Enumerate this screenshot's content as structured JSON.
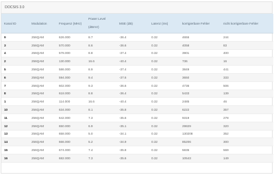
{
  "panel": {
    "title": "DOCSIS 3.0"
  },
  "columns": {
    "kanal_id": "Kanal ID",
    "modulation": "Modulation",
    "frequenz": "Frequenz (MHz)",
    "power_level_line1": "Power Level",
    "power_level_line2": "(dBmV)",
    "mse": "MSE (dB)",
    "latenz": "Latenz (ms)",
    "korrigierbare": "korrigierbare Fehler",
    "nicht_korrigierbare": "nicht korrigierbare Fehler"
  },
  "rows": [
    [
      "9",
      "256QAM",
      "626.000",
      "8.7",
      "-36.4",
      "0.32",
      "4655",
      "244"
    ],
    [
      "3",
      "256QAM",
      "570.000",
      "8.6",
      "-36.6",
      "0.32",
      "4058",
      "83"
    ],
    [
      "4",
      "256QAM",
      "578.000",
      "8.8",
      "-37.4",
      "0.32",
      "3901",
      "400"
    ],
    [
      "2",
      "256QAM",
      "130.000",
      "16.6",
      "-40.4",
      "0.32",
      "736",
      "16"
    ],
    [
      "5",
      "256QAM",
      "586.000",
      "8.9",
      "-37.4",
      "0.32",
      "3849",
      "441"
    ],
    [
      "6",
      "256QAM",
      "594.000",
      "9.4",
      "-37.6",
      "0.32",
      "3650",
      "333"
    ],
    [
      "7",
      "256QAM",
      "602.000",
      "9.3",
      "-36.6",
      "0.32",
      "4736",
      "506"
    ],
    [
      "8",
      "256QAM",
      "618.000",
      "8.8",
      "-36.4",
      "0.32",
      "5433",
      "139"
    ],
    [
      "1",
      "256QAM",
      "114.000",
      "16.6",
      "-40.4",
      "0.32",
      "2485",
      "46"
    ],
    [
      "10",
      "256QAM",
      "634.000",
      "8.1",
      "-35.8",
      "0.32",
      "6222",
      "357"
    ],
    [
      "11",
      "256QAM",
      "642.000",
      "7.3",
      "-35.6",
      "0.32",
      "9319",
      "278"
    ],
    [
      "12",
      "256QAM",
      "650.000",
      "6.9",
      "-35.1",
      "0.32",
      "29829",
      "320"
    ],
    [
      "13",
      "256QAM",
      "658.000",
      "5.0",
      "-34.1",
      "0.32",
      "130208",
      "352"
    ],
    [
      "14",
      "256QAM",
      "666.000",
      "5.2",
      "-34.9",
      "0.32",
      "85206",
      "300"
    ],
    [
      "15",
      "256QAM",
      "674.000",
      "7.4",
      "-35.8",
      "0.32",
      "5835",
      "569"
    ],
    [
      "16",
      "256QAM",
      "682.000",
      "7.3",
      "-35.6",
      "0.32",
      "10543",
      "149"
    ]
  ]
}
